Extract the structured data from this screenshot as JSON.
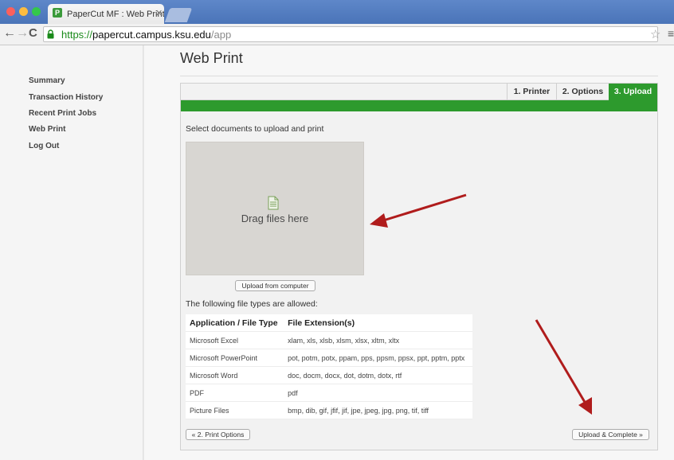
{
  "browser": {
    "tab_title": "PaperCut MF : Web Print",
    "tab_favicon": "P",
    "url_scheme": "https://",
    "url_host": "papercut.campus.ksu.edu",
    "url_path": "/app"
  },
  "sidebar": {
    "items": [
      {
        "label": "Summary"
      },
      {
        "label": "Transaction History"
      },
      {
        "label": "Recent Print Jobs"
      },
      {
        "label": "Web Print"
      },
      {
        "label": "Log Out"
      }
    ]
  },
  "page": {
    "title": "Web Print"
  },
  "wizard": {
    "steps": [
      {
        "label": "1. Printer",
        "active": false
      },
      {
        "label": "2. Options",
        "active": false
      },
      {
        "label": "3. Upload",
        "active": true
      }
    ],
    "accent_color": "#2d9a2d"
  },
  "upload": {
    "prompt": "Select documents to upload and print",
    "dropzone_text": "Drag files here",
    "dropzone_icon": "document-icon",
    "upload_button": "Upload from computer",
    "allowed_label": "The following file types are allowed:"
  },
  "file_types": {
    "headers": [
      "Application / File Type",
      "File Extension(s)"
    ],
    "rows": [
      [
        "Microsoft Excel",
        "xlam, xls, xlsb, xlsm, xlsx, xltm, xltx"
      ],
      [
        "Microsoft PowerPoint",
        "pot, potm, potx, ppam, pps, ppsm, ppsx, ppt, pptm, pptx"
      ],
      [
        "Microsoft Word",
        "doc, docm, docx, dot, dotm, dotx, rtf"
      ],
      [
        "PDF",
        "pdf"
      ],
      [
        "Picture Files",
        "bmp, dib, gif, jfif, jif, jpe, jpeg, jpg, png, tif, tiff"
      ]
    ]
  },
  "footer": {
    "back_button": "« 2. Print Options",
    "complete_button": "Upload & Complete »"
  },
  "annotations": {
    "arrow_color": "#b01c1c"
  }
}
